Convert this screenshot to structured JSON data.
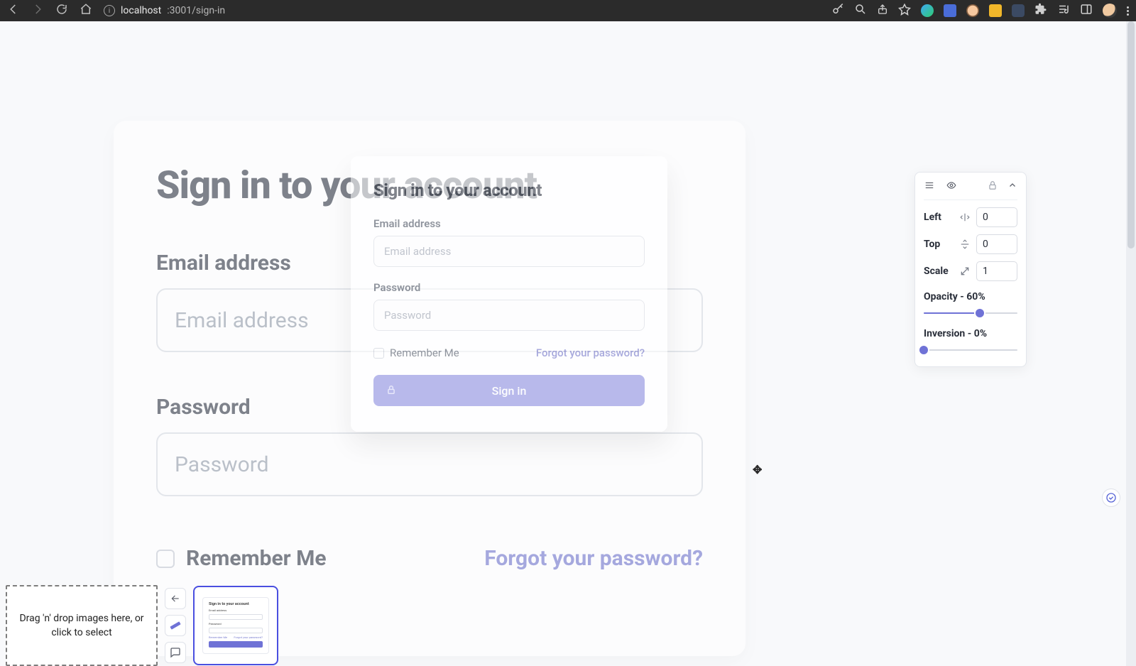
{
  "browser": {
    "url_host": "localhost",
    "url_port_path": ":3001/sign-in"
  },
  "page_large": {
    "heading": "Sign in to your account",
    "email_label": "Email address",
    "email_placeholder": "Email address",
    "password_label": "Password",
    "password_placeholder": "Password",
    "remember_label": "Remember Me",
    "forgot_label": "Forgot your password?"
  },
  "overlay": {
    "heading": "Sign in to your account",
    "email_label": "Email address",
    "email_placeholder": "Email address",
    "password_label": "Password",
    "password_placeholder": "Password",
    "remember_label": "Remember Me",
    "forgot_label": "Forgot your password?",
    "button_label": "Sign in"
  },
  "panel": {
    "left_label": "Left",
    "left_value": "0",
    "top_label": "Top",
    "top_value": "0",
    "scale_label": "Scale",
    "scale_value": "1",
    "opacity_label": "Opacity - 60%",
    "opacity_pct": 60,
    "inversion_label": "Inversion - 0%",
    "inversion_pct": 0
  },
  "dock": {
    "dropzone_text": "Drag 'n' drop images here, or click to select",
    "thumb_title": "Sign in to your account",
    "thumb_email": "Email address",
    "thumb_password": "Password",
    "thumb_remember": "Remember Me",
    "thumb_forgot": "Forgot your password?",
    "thumb_button": "Sign in"
  }
}
